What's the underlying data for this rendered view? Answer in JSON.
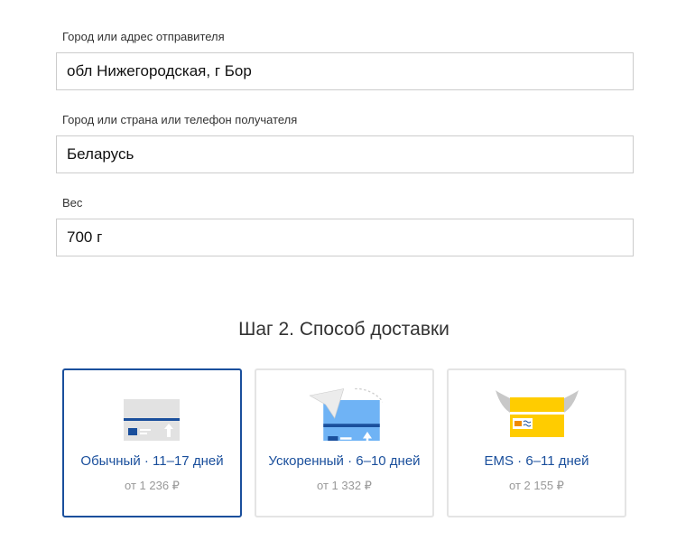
{
  "form": {
    "sender_label": "Город или адрес отправителя",
    "sender_value": "обл Нижегородская, г Бор",
    "recipient_label": "Город или страна или телефон получателя",
    "recipient_value": "Беларусь",
    "weight_label": "Вес",
    "weight_value": "700 г"
  },
  "step2": {
    "title": "Шаг 2. Способ доставки",
    "options": [
      {
        "title": "Обычный · 11–17 дней",
        "price": "от 1 236 ₽"
      },
      {
        "title": "Ускоренный · 6–10 дней",
        "price": "от 1 332 ₽"
      },
      {
        "title": "EMS · 6–11 дней",
        "price": "от 2 155 ₽"
      }
    ]
  },
  "colors": {
    "accent": "#1a4f9c",
    "ems": "#ffcc00",
    "express": "#5aa9f0"
  }
}
